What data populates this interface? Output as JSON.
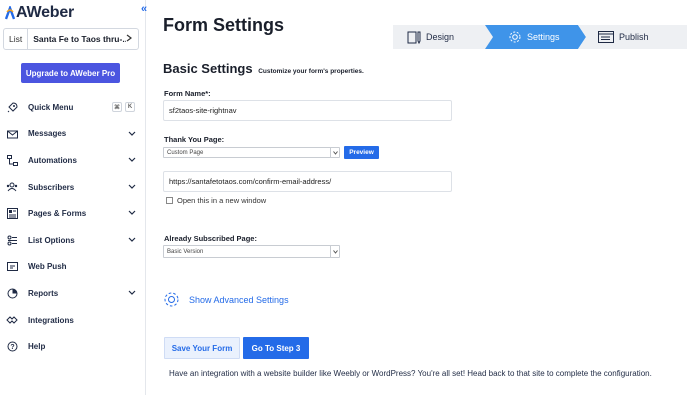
{
  "brand": {
    "name": "AWeber",
    "collapse_glyph": "«"
  },
  "sidebar": {
    "list_label": "List",
    "list_value": "Santa Fe to Taos thru-...",
    "upgrade_label": "Upgrade to AWeber Pro",
    "quick_menu_keys": [
      "⌘",
      "K"
    ],
    "items": [
      {
        "label": "Quick Menu",
        "icon": "rocket-icon",
        "has_chevron": false
      },
      {
        "label": "Messages",
        "icon": "envelope-icon",
        "has_chevron": true
      },
      {
        "label": "Automations",
        "icon": "automation-icon",
        "has_chevron": true
      },
      {
        "label": "Subscribers",
        "icon": "subscribers-icon",
        "has_chevron": true
      },
      {
        "label": "Pages & Forms",
        "icon": "pages-forms-icon",
        "has_chevron": true
      },
      {
        "label": "List Options",
        "icon": "list-options-icon",
        "has_chevron": true
      },
      {
        "label": "Web Push",
        "icon": "web-push-icon",
        "has_chevron": false
      },
      {
        "label": "Reports",
        "icon": "reports-icon",
        "has_chevron": true
      },
      {
        "label": "Integrations",
        "icon": "integrations-icon",
        "has_chevron": false
      },
      {
        "label": "Help",
        "icon": "help-icon",
        "has_chevron": false
      }
    ]
  },
  "page": {
    "title": "Form Settings",
    "steps": [
      {
        "label": "Design",
        "icon": "design-icon",
        "active": false
      },
      {
        "label": "Settings",
        "icon": "gear-icon",
        "active": true
      },
      {
        "label": "Publish",
        "icon": "publish-icon",
        "active": false
      }
    ],
    "section_title": "Basic Settings",
    "section_subtitle": "Customize your form's properties.",
    "form_name_label": "Form Name*:",
    "form_name_value": "sf2taos-site-rightnav",
    "thank_you_label": "Thank You Page:",
    "thank_you_select": "Custom Page",
    "preview_label": "Preview",
    "thank_you_url": "https://santafetotaos.com/confirm-email-address/",
    "open_new_window_label": "Open this in a new window",
    "already_subscribed_label": "Already Subscribed Page:",
    "already_subscribed_select": "Basic Version",
    "advanced_label": "Show Advanced Settings",
    "save_label": "Save Your Form",
    "step3_label": "Go To Step 3",
    "footer_note": "Have an integration with a website builder like Weebly or WordPress? You're all set! Head back to that site to complete the configuration."
  },
  "colors": {
    "accent": "#246be8",
    "upgrade": "#4b55e0",
    "step_active": "#3f94e9"
  }
}
